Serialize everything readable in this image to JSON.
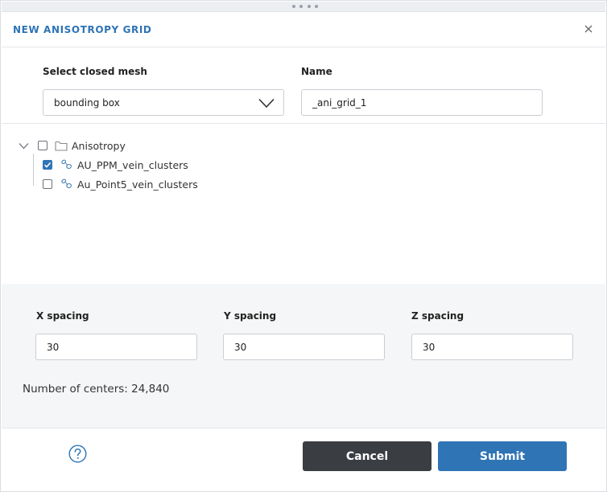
{
  "dialog": {
    "title": "NEW ANISOTROPY GRID",
    "close_icon": "close-icon"
  },
  "mesh": {
    "label": "Select closed mesh",
    "value": "bounding box",
    "icon": "chevron-down-icon"
  },
  "name": {
    "label": "Name",
    "value": "_ani_grid_1"
  },
  "tree": {
    "root": {
      "label": "Anisotropy",
      "checked": false,
      "expanded": true,
      "icon": "folder-icon"
    },
    "children": [
      {
        "label": "AU_PPM_vein_clusters",
        "checked": true,
        "icon": "vein-cluster-icon"
      },
      {
        "label": "Au_Point5_vein_clusters",
        "checked": false,
        "icon": "vein-cluster-icon"
      }
    ]
  },
  "spacing": {
    "x": {
      "label": "X spacing",
      "value": "30"
    },
    "y": {
      "label": "Y spacing",
      "value": "30"
    },
    "z": {
      "label": "Z spacing",
      "value": "30"
    }
  },
  "centers": {
    "text": "Number of centers: 24,840"
  },
  "footer": {
    "help_icon": "help-icon",
    "cancel_label": "Cancel",
    "submit_label": "Submit"
  },
  "colors": {
    "accent": "#2f74b5",
    "cancel": "#3a3d42",
    "panel_bg": "#f5f6f7"
  }
}
